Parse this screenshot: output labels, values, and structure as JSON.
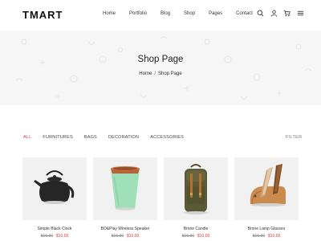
{
  "brand": {
    "logo": "TMART"
  },
  "nav": {
    "items": [
      "Home",
      "Portfolio",
      "Blog",
      "Shop",
      "Pages",
      "Contact"
    ]
  },
  "header_icons": [
    "search-icon",
    "user-icon",
    "cart-icon",
    "menu-icon"
  ],
  "banner": {
    "title": "Shop Page",
    "breadcrumb": {
      "home": "Home",
      "separator": "/",
      "current": "Shop Page"
    }
  },
  "filters": {
    "categories": [
      "ALL",
      "FURNITURES",
      "BAGS",
      "DECORATION",
      "ACCESSORIES"
    ],
    "active": "ALL",
    "filter_label": "FILTER"
  },
  "products": [
    {
      "name": "Simple Black Clock",
      "old_price": "$16.00",
      "price": "$10.00",
      "image": "black-teapot"
    },
    {
      "name": "BO&Play Wireless Speaker",
      "old_price": "$16.00",
      "price": "$10.00",
      "image": "green-speaker"
    },
    {
      "name": "Brone Candle",
      "old_price": "$16.00",
      "price": "$10.00",
      "image": "backpack"
    },
    {
      "name": "Brone Lamp Glasses",
      "old_price": "$16.00",
      "price": "$10.00",
      "image": "wood-phone-stand"
    }
  ],
  "colors": {
    "accent": "#e53935",
    "banner_bg": "#f6f6f6",
    "card_bg": "#f1f1f1"
  }
}
